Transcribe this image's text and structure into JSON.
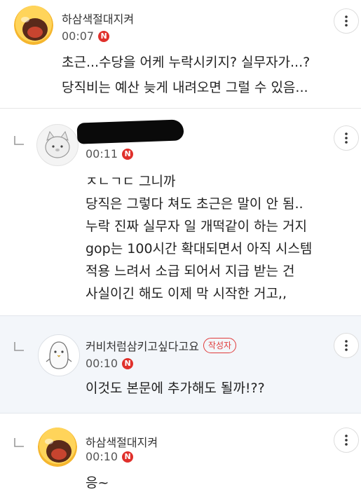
{
  "comments": [
    {
      "nickname": "하삼색절대지켜",
      "time": "00:07",
      "new_badge": "N",
      "lines": [
        "초근...수당을 어케 누락시키지? 실무자가...?",
        "당직비는 예산 늦게 내려오면 그럴 수 있음..."
      ]
    },
    {
      "nickname": "",
      "time": "00:11",
      "new_badge": "N",
      "lines": [
        "ㅈㄴㄱㄷ 그니까",
        "당직은 그렇다 쳐도 초근은 말이 안 됨..",
        "누락 진짜 실무자 일 개떡같이 하는 거지",
        "gop는 100시간 확대되면서 아직 시스템",
        "적용 느려서 소급 되어서 지급 받는 건",
        "사실이긴 해도 이제 막 시작한 거고,,"
      ]
    },
    {
      "nickname": "커비처럼삼키고싶다고요",
      "author_badge": "작성자",
      "time": "00:10",
      "new_badge": "N",
      "lines": [
        "이것도 본문에 추가해도 될까!??"
      ]
    },
    {
      "nickname": "하삼색절대지켜",
      "time": "00:10",
      "new_badge": "N",
      "lines": [
        "응~"
      ]
    }
  ],
  "icons": {
    "more": "more-vertical-icon",
    "reply": "reply-arrow-icon",
    "avatar_emoji": "screaming-face-avatar",
    "avatar_cat": "cat-avatar",
    "avatar_ghost": "penguin-avatar"
  },
  "colors": {
    "accent_red": "#e0302b",
    "author_highlight_bg": "#f3f6fa"
  }
}
